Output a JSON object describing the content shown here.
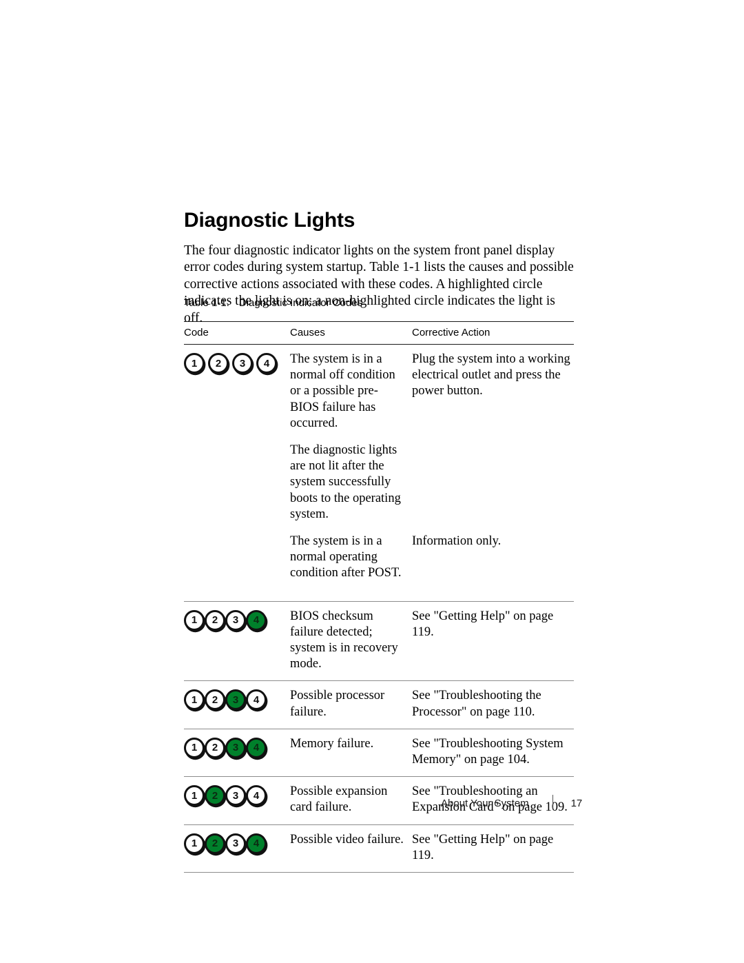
{
  "document": {
    "section_title": "Diagnostic Lights",
    "intro_paragraph": "The four diagnostic indicator lights on the system front panel display error codes during system startup. Table 1-1 lists the causes and possible corrective actions associated with these codes. A highlighted circle indicates the light is on; a non-highlighted circle indicates the light is off."
  },
  "table": {
    "caption_number": "Table 1-1.",
    "caption_title": "Diagnostic Indicator Codes",
    "columns": [
      "Code",
      "Causes",
      "Corrective Action"
    ],
    "led_labels": [
      "1",
      "2",
      "3",
      "4"
    ],
    "accent_on_color": "#00802b",
    "rows": [
      {
        "leds": [
          false,
          false,
          false,
          false
        ],
        "led_spacing": "spread",
        "entries": [
          {
            "cause": "The system is in a normal off condition or a possible pre-BIOS failure has occurred.",
            "action": "Plug the system into a working electrical outlet and press the power button."
          },
          {
            "cause": "The diagnostic lights are not lit after the system successfully boots to the operating system.",
            "action": ""
          },
          {
            "cause": "The system is in a normal operating condition after POST.",
            "action": "Information only."
          }
        ]
      },
      {
        "leds": [
          false,
          false,
          false,
          true
        ],
        "led_spacing": "tight",
        "entries": [
          {
            "cause": "BIOS checksum failure detected; system is in recovery mode.",
            "action": "See \"Getting Help\" on page 119."
          }
        ]
      },
      {
        "leds": [
          false,
          false,
          true,
          false
        ],
        "led_spacing": "tight",
        "entries": [
          {
            "cause": "Possible processor failure.",
            "action": "See \"Troubleshooting the Processor\" on page 110."
          }
        ]
      },
      {
        "leds": [
          false,
          false,
          true,
          true
        ],
        "led_spacing": "tight",
        "entries": [
          {
            "cause": "Memory failure.",
            "action": "See \"Troubleshooting System Memory\" on page 104."
          }
        ]
      },
      {
        "leds": [
          false,
          true,
          false,
          false
        ],
        "led_spacing": "tight",
        "entries": [
          {
            "cause": "Possible expansion card failure.",
            "action": "See \"Troubleshooting an Expansion Card\" on page 109."
          }
        ]
      },
      {
        "leds": [
          false,
          true,
          false,
          true
        ],
        "led_spacing": "tight",
        "entries": [
          {
            "cause": "Possible video failure.",
            "action": "See \"Getting Help\" on page 119."
          }
        ]
      }
    ]
  },
  "footer": {
    "chapter": "About Your System",
    "separator": "|",
    "page_number": "17"
  }
}
